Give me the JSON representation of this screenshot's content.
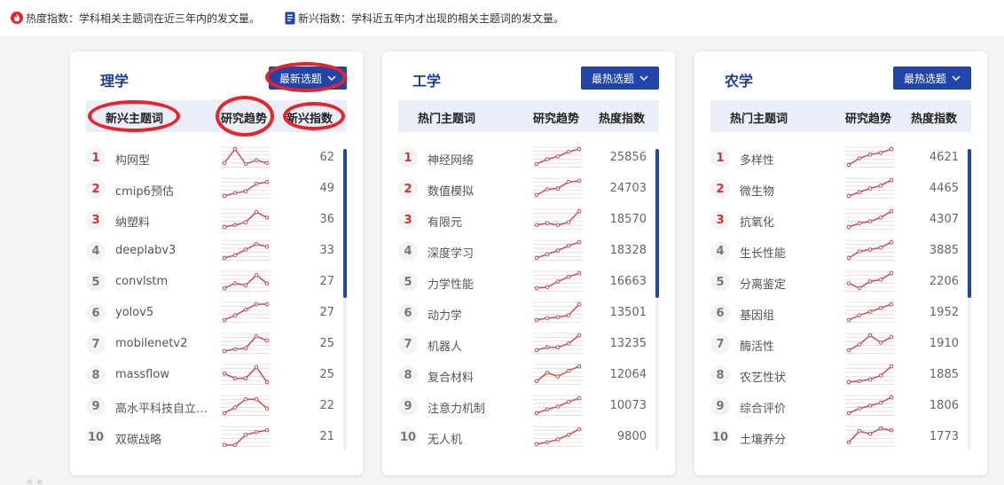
{
  "legend": {
    "hot_text": "热度指数：学科相关主题词在近三年内的发文量。",
    "new_text": "新兴指数：学科近五年内才出现的相关主题词的发文量。",
    "hot_color": "#e8232a",
    "new_color": "#2445a8"
  },
  "bottom_mark": "« «",
  "cards": [
    {
      "title": "理学",
      "select_label": "最新选题",
      "headers": {
        "term": "新兴主题词",
        "trend": "研究趋势",
        "index": "新兴指数"
      },
      "rows": [
        {
          "rank": "1",
          "term": "构网型",
          "value": "62",
          "trend": [
            0.2,
            0.95,
            0.15,
            0.35,
            0.2
          ]
        },
        {
          "rank": "2",
          "term": "cmip6预估",
          "value": "49",
          "trend": [
            0.1,
            0.25,
            0.35,
            0.75,
            0.85
          ]
        },
        {
          "rank": "3",
          "term": "纳塑料",
          "value": "36",
          "trend": [
            0.1,
            0.2,
            0.35,
            0.9,
            0.6
          ]
        },
        {
          "rank": "4",
          "term": "deeplabv3",
          "value": "33",
          "trend": [
            0.1,
            0.25,
            0.55,
            0.85,
            0.7
          ]
        },
        {
          "rank": "5",
          "term": "convlstm",
          "value": "27",
          "trend": [
            0.15,
            0.4,
            0.3,
            0.85,
            0.4
          ]
        },
        {
          "rank": "6",
          "term": "yolov5",
          "value": "27",
          "trend": [
            0.1,
            0.35,
            0.65,
            0.95,
            0.95
          ]
        },
        {
          "rank": "7",
          "term": "mobilenetv2",
          "value": "25",
          "trend": [
            0.1,
            0.2,
            0.25,
            0.9,
            0.65
          ]
        },
        {
          "rank": "8",
          "term": "massflow",
          "value": "25",
          "trend": [
            0.55,
            0.3,
            0.3,
            0.9,
            0.1
          ]
        },
        {
          "rank": "9",
          "term": "高水平科技自立自...",
          "value": "22",
          "trend": [
            0.1,
            0.4,
            0.85,
            0.85,
            0.35
          ]
        },
        {
          "rank": "10",
          "term": "双碳战略",
          "value": "21",
          "trend": [
            0.05,
            0.05,
            0.6,
            0.75,
            0.85
          ]
        }
      ]
    },
    {
      "title": "工学",
      "select_label": "最热选题",
      "headers": {
        "term": "热门主题词",
        "trend": "研究趋势",
        "index": "热度指数"
      },
      "rows": [
        {
          "rank": "1",
          "term": "神经网络",
          "value": "25856",
          "trend": [
            0.15,
            0.4,
            0.55,
            0.8,
            0.95
          ]
        },
        {
          "rank": "2",
          "term": "数值模拟",
          "value": "24703",
          "trend": [
            0.15,
            0.45,
            0.5,
            0.85,
            0.9
          ]
        },
        {
          "rank": "3",
          "term": "有限元",
          "value": "18570",
          "trend": [
            0.2,
            0.3,
            0.2,
            0.35,
            0.95
          ]
        },
        {
          "rank": "4",
          "term": "深度学习",
          "value": "18328",
          "trend": [
            0.1,
            0.3,
            0.5,
            0.75,
            0.95
          ]
        },
        {
          "rank": "5",
          "term": "力学性能",
          "value": "16663",
          "trend": [
            0.15,
            0.2,
            0.5,
            0.75,
            0.95
          ]
        },
        {
          "rank": "6",
          "term": "动力学",
          "value": "13501",
          "trend": [
            0.1,
            0.2,
            0.25,
            0.35,
            0.95
          ]
        },
        {
          "rank": "7",
          "term": "机器人",
          "value": "13235",
          "trend": [
            0.15,
            0.3,
            0.3,
            0.5,
            0.95
          ]
        },
        {
          "rank": "8",
          "term": "复合材料",
          "value": "12064",
          "trend": [
            0.15,
            0.6,
            0.4,
            0.7,
            0.95
          ]
        },
        {
          "rank": "9",
          "term": "注意力机制",
          "value": "10073",
          "trend": [
            0.1,
            0.3,
            0.45,
            0.7,
            0.9
          ]
        },
        {
          "rank": "10",
          "term": "无人机",
          "value": "9800",
          "trend": [
            0.1,
            0.2,
            0.35,
            0.6,
            0.9
          ]
        }
      ]
    },
    {
      "title": "农学",
      "select_label": "最热选题",
      "headers": {
        "term": "热门主题词",
        "trend": "研究趋势",
        "index": "热度指数"
      },
      "rows": [
        {
          "rank": "1",
          "term": "多样性",
          "value": "4621",
          "trend": [
            0.1,
            0.45,
            0.65,
            0.75,
            0.95
          ]
        },
        {
          "rank": "2",
          "term": "微生物",
          "value": "4465",
          "trend": [
            0.1,
            0.3,
            0.5,
            0.65,
            0.95
          ]
        },
        {
          "rank": "3",
          "term": "抗氧化",
          "value": "4307",
          "trend": [
            0.1,
            0.3,
            0.4,
            0.6,
            0.95
          ]
        },
        {
          "rank": "4",
          "term": "生长性能",
          "value": "3885",
          "trend": [
            0.1,
            0.45,
            0.55,
            0.65,
            0.95
          ]
        },
        {
          "rank": "5",
          "term": "分离鉴定",
          "value": "2206",
          "trend": [
            0.4,
            0.15,
            0.5,
            0.6,
            0.95
          ]
        },
        {
          "rank": "6",
          "term": "基因组",
          "value": "1952",
          "trend": [
            0.1,
            0.35,
            0.55,
            0.75,
            0.95
          ]
        },
        {
          "rank": "7",
          "term": "酶活性",
          "value": "1910",
          "trend": [
            0.15,
            0.45,
            0.95,
            0.55,
            0.85
          ]
        },
        {
          "rank": "8",
          "term": "农艺性状",
          "value": "1885",
          "trend": [
            0.1,
            0.15,
            0.25,
            0.45,
            0.95
          ]
        },
        {
          "rank": "9",
          "term": "综合评价",
          "value": "1806",
          "trend": [
            0.1,
            0.35,
            0.5,
            0.65,
            0.95
          ]
        },
        {
          "rank": "10",
          "term": "土壤养分",
          "value": "1773",
          "trend": [
            0.2,
            0.8,
            0.65,
            0.95,
            0.85
          ]
        }
      ]
    }
  ]
}
